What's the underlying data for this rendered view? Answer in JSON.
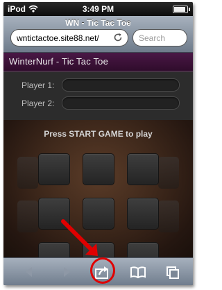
{
  "status_bar": {
    "carrier": "iPod",
    "time": "3:49 PM",
    "battery_level": 0.9
  },
  "browser": {
    "page_title": "WN - Tic Tac Toe",
    "url": "wntictactoe.site88.net/",
    "search_placeholder": "Search"
  },
  "page": {
    "site_title": "WinterNurf - Tic Tac Toe",
    "players": [
      {
        "label": "Player 1:",
        "value": ""
      },
      {
        "label": "Player 2:",
        "value": ""
      }
    ],
    "status_message": "Press START GAME to play"
  },
  "toolbar": {
    "buttons": [
      "back-icon",
      "forward-icon",
      "share-icon",
      "bookmarks-icon",
      "pages-icon"
    ]
  },
  "annotation": {
    "color": "#e00000"
  }
}
